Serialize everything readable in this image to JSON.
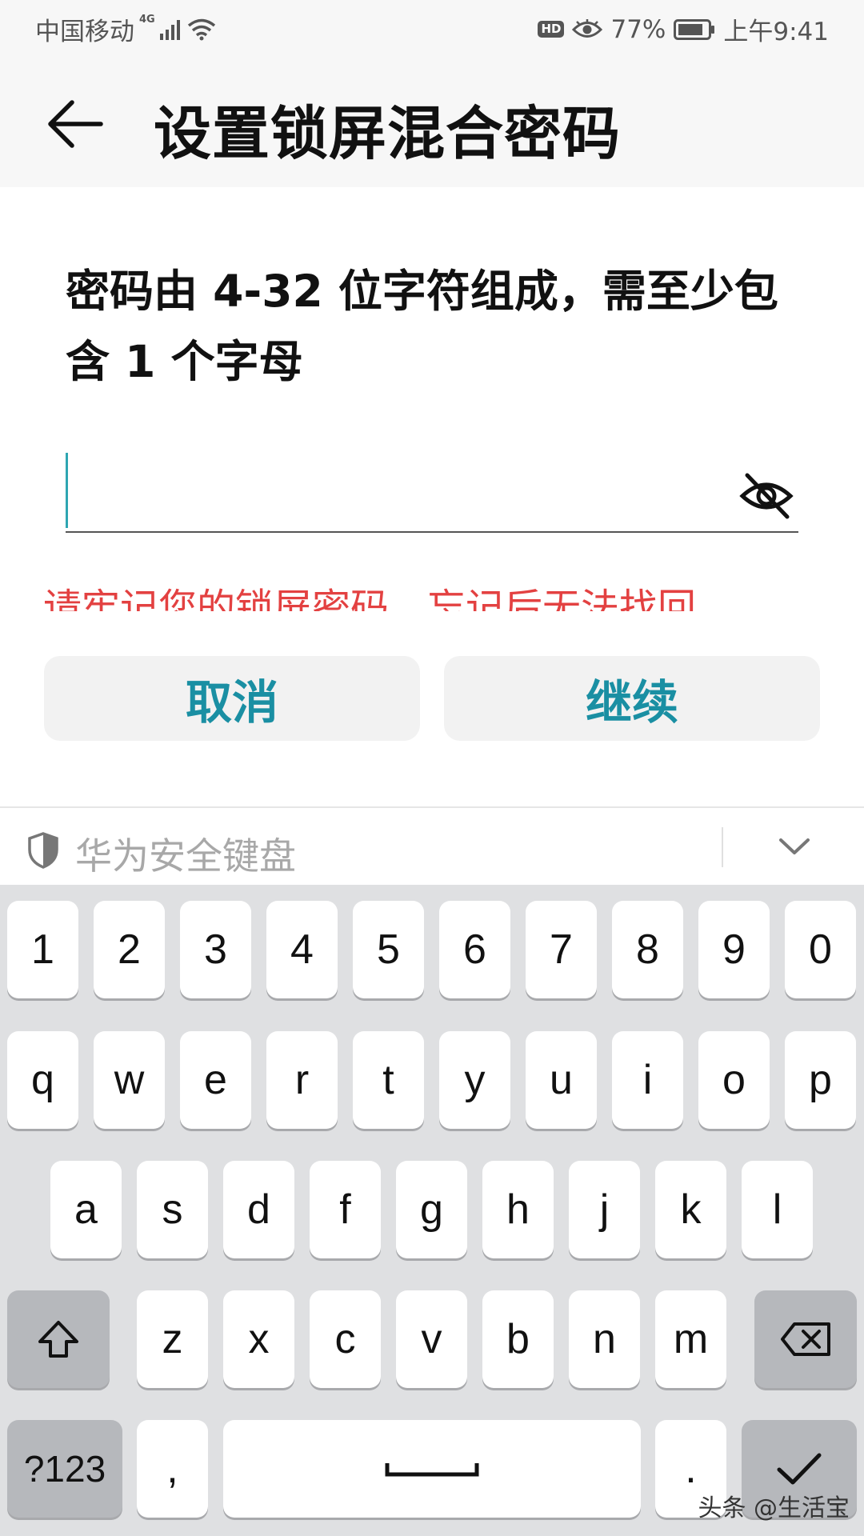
{
  "status": {
    "carrier": "中国移动",
    "network": "4G",
    "hd": "HD",
    "battery": "77%",
    "time": "上午9:41"
  },
  "header": {
    "title": "设置锁屏混合密码"
  },
  "content": {
    "instruction": "密码由 4-32 位字符组成，需至少包含 1 个字母",
    "password_value": "",
    "warning": "请牢记您的锁屏密码，忘记后无法找回",
    "cancel_label": "取消",
    "continue_label": "继续",
    "accent_color": "#1a8fa3",
    "warning_color": "#e34141"
  },
  "keyboard": {
    "title": "华为安全键盘",
    "row1": [
      "1",
      "2",
      "3",
      "4",
      "5",
      "6",
      "7",
      "8",
      "9",
      "0"
    ],
    "row2": [
      "q",
      "w",
      "e",
      "r",
      "t",
      "y",
      "u",
      "i",
      "o",
      "p"
    ],
    "row3": [
      "a",
      "s",
      "d",
      "f",
      "g",
      "h",
      "j",
      "k",
      "l"
    ],
    "row4": [
      "z",
      "x",
      "c",
      "v",
      "b",
      "n",
      "m"
    ],
    "symbols_label": "?123",
    "comma": ",",
    "period": "."
  },
  "watermark": "头条 @生活宝"
}
